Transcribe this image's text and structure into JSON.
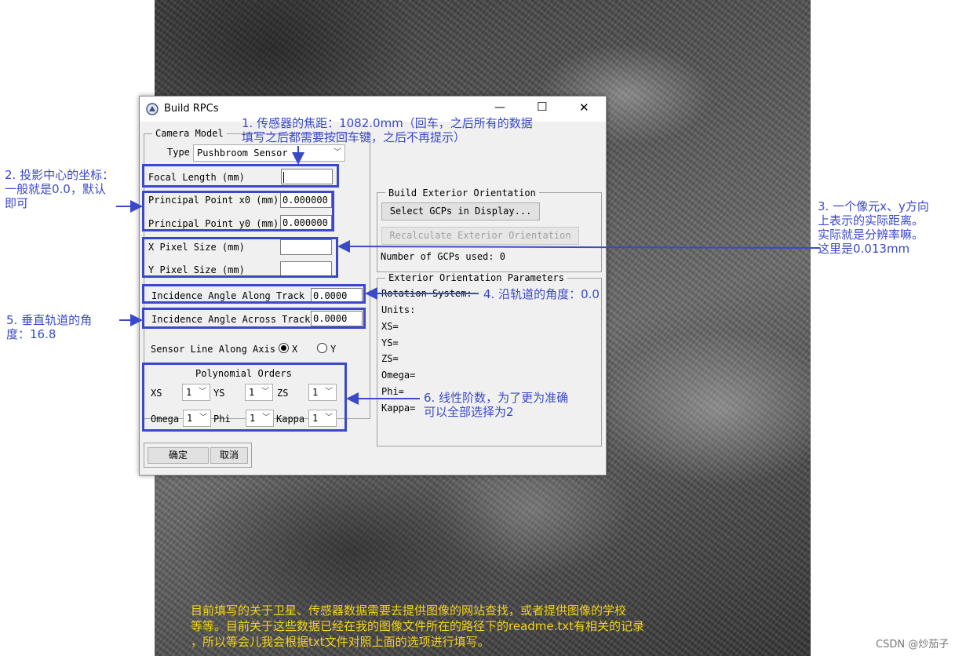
{
  "dialog": {
    "title": "Build RPCs",
    "window_controls": {
      "minimize": "—",
      "maximize": "☐",
      "close": "✕"
    },
    "camera_model": {
      "legend": "Camera Model",
      "type_label": "Type",
      "type_value": "Pushbroom Sensor"
    },
    "focal_length_label": "Focal Length (mm)",
    "focal_length_value": "",
    "principal_x_label": "Principal Point x0 (mm)",
    "principal_x_value": "0.000000",
    "principal_y_label": "Principal Point y0 (mm)",
    "principal_y_value": "0.000000",
    "x_pixel_label": "X Pixel Size (mm)",
    "x_pixel_value": "",
    "y_pixel_label": "Y Pixel Size (mm)",
    "y_pixel_value": "",
    "incidence_along_label": "Incidence Angle Along Track",
    "incidence_along_value": "0.0000",
    "incidence_across_label": "Incidence Angle Across Track",
    "incidence_across_value": "0.0000",
    "sensor_line_label": "Sensor Line Along Axis",
    "sensor_line_x": "X",
    "sensor_line_y": "Y",
    "polynomial": {
      "title": "Polynomial Orders",
      "xs_label": "XS",
      "xs_value": "1",
      "ys_label": "YS",
      "ys_value": "1",
      "zs_label": "ZS",
      "zs_value": "1",
      "omega_label": "Omega",
      "omega_value": "1",
      "phi_label": "Phi",
      "phi_value": "1",
      "kappa_label": "Kappa",
      "kappa_value": "1"
    },
    "ok_label": "确定",
    "cancel_label": "取消",
    "build_exterior": {
      "legend": "Build Exterior Orientation",
      "select_gcps": "Select GCPs in Display...",
      "recalculate": "Recalculate Exterior Orientation",
      "num_gcps": "Number of GCPs used: 0"
    },
    "exterior_params": {
      "legend": "Exterior Orientation Parameters",
      "rotation_system": "Rotation System:",
      "units": "Units:",
      "xs": "XS=",
      "ys": "YS=",
      "zs": "ZS=",
      "omega": "Omega=",
      "phi": "Phi=",
      "kappa": "Kappa="
    }
  },
  "annotations": {
    "a1_line1": "1. 传感器的焦距：1082.0mm（回车，之后所有的数据",
    "a1_line2": "填写之后都需要按回车键，之后不再提示）",
    "a2_line1": "2. 投影中心的坐标：",
    "a2_line2": "一般就是0.0，默认",
    "a2_line3": "即可",
    "a3_line1": "3. 一个像元x、y方向",
    "a3_line2": "上表示的实际距离。",
    "a3_line3": "实际就是分辨率嘛。",
    "a3_line4": "这里是0.013mm",
    "a4": "4. 沿轨道的角度：0.0",
    "a5_line1": "5. 垂直轨道的角",
    "a5_line2": "度：16.8",
    "a6_line1": "6. 线性阶数，为了更为准确",
    "a6_line2": "可以全部选择为2",
    "footer_line1": "目前填写的关于卫星、传感器数据需要去提供图像的网站查找，或者提供图像的学校",
    "footer_line2": "等等。目前关于这些数据已经在我的图像文件所在的路径下的readme.txt有相关的记录",
    "footer_line3": "，所以等会儿我会根据txt文件对照上面的选项进行填写。"
  },
  "watermark": "CSDN @炒茄子",
  "colors": {
    "annotation_blue": "#3a49c9",
    "footer_yellow": "#f4d21b"
  }
}
